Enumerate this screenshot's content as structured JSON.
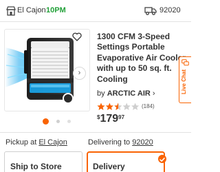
{
  "header": {
    "store_icon": "store-icon",
    "store_name": "El Cajon",
    "store_hours": "10PM",
    "delivery_icon": "truck-icon",
    "zip_code": "92020"
  },
  "gallery": {
    "favorite_icon": "heart-outline-icon",
    "next_icon": "chevron-right-icon",
    "next_glyph": "›",
    "image_count": 3,
    "active_index": 0
  },
  "product": {
    "title": "1300 CFM 3-Speed Settings Portable Evaporative Air Cooler with up to 50 sq. ft. Cooling",
    "brand_prefix": "by",
    "brand": "ARCTIC AIR",
    "brand_chevron": "›",
    "rating": 2.5,
    "rating_max": 5,
    "review_count": "(184)",
    "price_currency": "$",
    "price_dollars": "179",
    "price_cents": "97"
  },
  "fulfillment": {
    "pickup_prefix": "Pickup at",
    "pickup_store": "El Cajon",
    "delivery_prefix": "Delivering to",
    "delivery_zip": "92020",
    "options": [
      {
        "label": "Ship to Store",
        "selected": false
      },
      {
        "label": "Delivery",
        "selected": true
      }
    ]
  },
  "live_chat": {
    "label": "Live Chat",
    "icon": "chat-bubbles-icon"
  },
  "colors": {
    "brand_orange": "#f96302",
    "open_green": "#21a038",
    "cooler_blue": "#1aa7ec"
  }
}
